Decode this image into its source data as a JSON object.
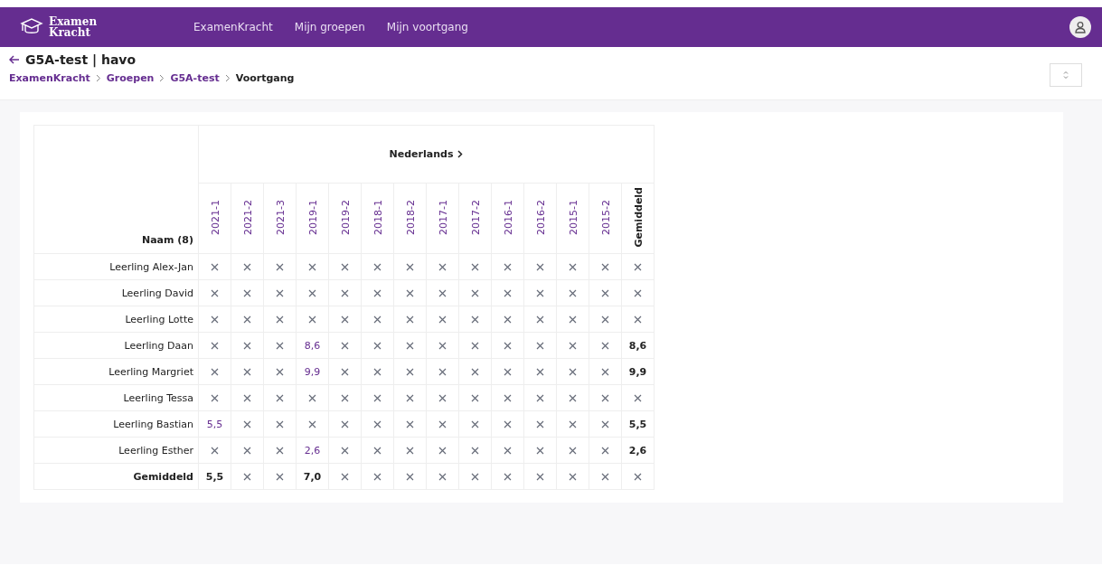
{
  "nav": {
    "logo": [
      "Examen",
      "Kracht"
    ],
    "links": [
      "ExamenKracht",
      "Mijn groepen",
      "Mijn voortgang"
    ]
  },
  "page": {
    "title": "G5A-test | havo",
    "breadcrumb": [
      {
        "label": "ExamenKracht",
        "current": false
      },
      {
        "label": "Groepen",
        "current": false
      },
      {
        "label": "G5A-test",
        "current": false
      },
      {
        "label": "Voortgang",
        "current": true
      }
    ]
  },
  "table": {
    "name_header": "Naam (8)",
    "subject": "Nederlands",
    "columns": [
      {
        "label": "2021-1",
        "kind": "exam"
      },
      {
        "label": "2021-2",
        "kind": "exam"
      },
      {
        "label": "2021-3",
        "kind": "exam"
      },
      {
        "label": "2019-1",
        "kind": "exam"
      },
      {
        "label": "2019-2",
        "kind": "exam"
      },
      {
        "label": "2018-1",
        "kind": "exam"
      },
      {
        "label": "2018-2",
        "kind": "exam"
      },
      {
        "label": "2017-1",
        "kind": "exam"
      },
      {
        "label": "2017-2",
        "kind": "exam"
      },
      {
        "label": "2016-1",
        "kind": "exam"
      },
      {
        "label": "2016-2",
        "kind": "exam"
      },
      {
        "label": "2015-1",
        "kind": "exam"
      },
      {
        "label": "2015-2",
        "kind": "exam"
      },
      {
        "label": "Gemiddeld",
        "kind": "average"
      }
    ],
    "rows": [
      {
        "name": "Leerling Alex-Jan",
        "kind": "student",
        "cells": [
          null,
          null,
          null,
          null,
          null,
          null,
          null,
          null,
          null,
          null,
          null,
          null,
          null,
          null
        ]
      },
      {
        "name": "Leerling David",
        "kind": "student",
        "cells": [
          null,
          null,
          null,
          null,
          null,
          null,
          null,
          null,
          null,
          null,
          null,
          null,
          null,
          null
        ]
      },
      {
        "name": "Leerling Lotte",
        "kind": "student",
        "cells": [
          null,
          null,
          null,
          null,
          null,
          null,
          null,
          null,
          null,
          null,
          null,
          null,
          null,
          null
        ]
      },
      {
        "name": "Leerling Daan",
        "kind": "student",
        "cells": [
          null,
          null,
          null,
          "8,6",
          null,
          null,
          null,
          null,
          null,
          null,
          null,
          null,
          null,
          "8,6"
        ]
      },
      {
        "name": "Leerling Margriet",
        "kind": "student",
        "cells": [
          null,
          null,
          null,
          "9,9",
          null,
          null,
          null,
          null,
          null,
          null,
          null,
          null,
          null,
          "9,9"
        ]
      },
      {
        "name": "Leerling Tessa",
        "kind": "student",
        "cells": [
          null,
          null,
          null,
          null,
          null,
          null,
          null,
          null,
          null,
          null,
          null,
          null,
          null,
          null
        ]
      },
      {
        "name": "Leerling Bastian",
        "kind": "student",
        "cells": [
          "5,5",
          null,
          null,
          null,
          null,
          null,
          null,
          null,
          null,
          null,
          null,
          null,
          null,
          "5,5"
        ]
      },
      {
        "name": "Leerling Esther",
        "kind": "student",
        "cells": [
          null,
          null,
          null,
          "2,6",
          null,
          null,
          null,
          null,
          null,
          null,
          null,
          null,
          null,
          "2,6"
        ]
      },
      {
        "name": "Gemiddeld",
        "kind": "average",
        "cells": [
          "5,5",
          null,
          null,
          "7,0",
          null,
          null,
          null,
          null,
          null,
          null,
          null,
          null,
          null,
          null
        ]
      }
    ]
  }
}
